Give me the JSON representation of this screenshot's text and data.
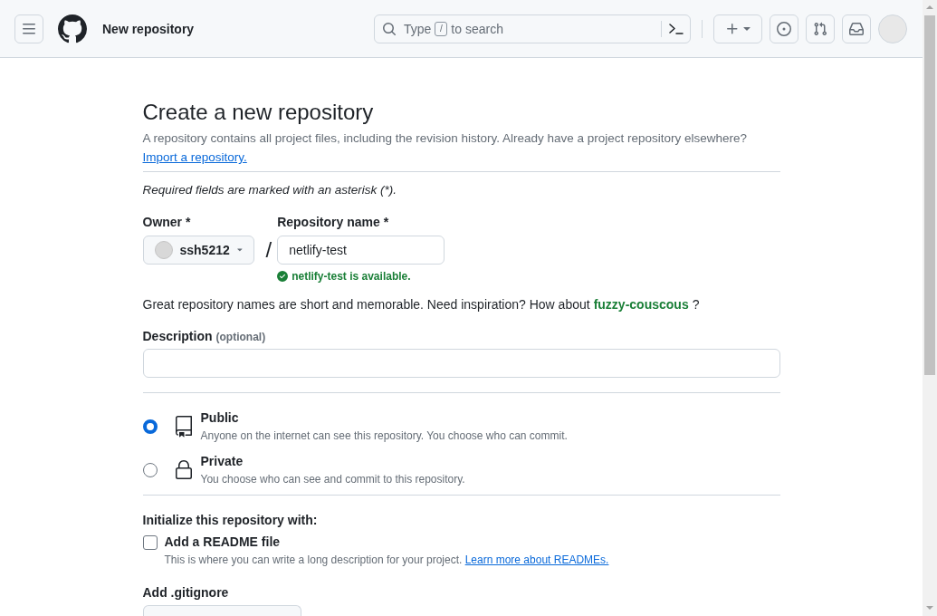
{
  "header": {
    "title": "New repository",
    "search": {
      "prefix": "Type",
      "key": "/",
      "suffix": "to search"
    }
  },
  "page": {
    "title": "Create a new repository",
    "intro": "A repository contains all project files, including the revision history. Already have a project repository elsewhere?",
    "import_link": "Import a repository.",
    "required_note": "Required fields are marked with an asterisk (*)."
  },
  "owner": {
    "label": "Owner *",
    "value": "ssh5212"
  },
  "separator": "/",
  "repo_name": {
    "label": "Repository name *",
    "value": "netlify-test",
    "status": "netlify-test is available.",
    "available": true
  },
  "suggestion": {
    "text": "Great repository names are short and memorable. Need inspiration? How about",
    "name": "fuzzy-couscous",
    "end": "?"
  },
  "description": {
    "label": "Description",
    "hint": "(optional)"
  },
  "visibility": [
    {
      "kind": "public",
      "label": "Public",
      "text": "Anyone on the internet can see this repository. You choose who can commit.",
      "selected": true
    },
    {
      "kind": "private",
      "label": "Private",
      "text": "You choose who can see and commit to this repository.",
      "selected": false
    }
  ],
  "initialize": {
    "heading": "Initialize this repository with:",
    "readme": {
      "label": "Add a README file",
      "checked": false,
      "text": "This is where you can write a long description for your project.",
      "link": "Learn more about READMEs."
    }
  },
  "gitignore": {
    "label": "Add .gitignore"
  }
}
